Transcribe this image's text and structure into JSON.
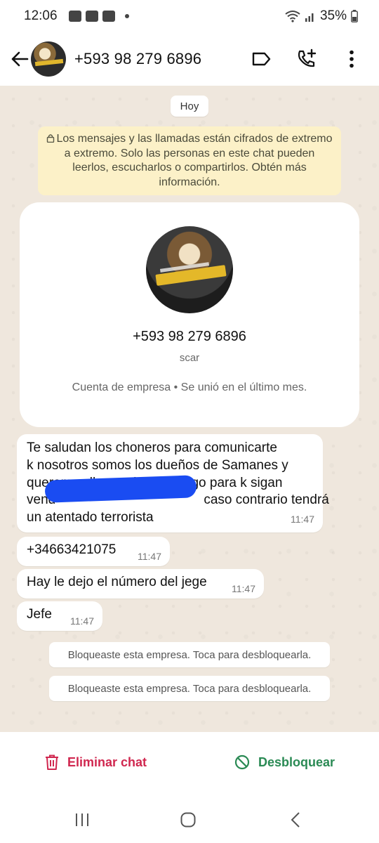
{
  "status_bar": {
    "time": "12:06",
    "battery": "35%"
  },
  "header": {
    "contact_phone": "+593 98 279 6896"
  },
  "chat": {
    "date_label": "Hoy",
    "encryption_notice": "Los mensajes y las llamadas están cifrados de extremo a extremo. Solo las personas en este chat pueden leerlos, escucharlos o compartirlos. Obtén más información.",
    "profile_card": {
      "phone": "+593 98 279 6896",
      "name": "scar",
      "description": "Cuenta de empresa • Se unió en el último mes."
    },
    "messages": [
      {
        "lines": [
          "Te saludan los choneros para comunicarte",
          "k nosotros somos los dueños de Samanes y",
          "queremos llegar ah un diálogo para k sigan",
          "vend                                        caso contrario tendrá",
          "un atentado terrorista"
        ],
        "time": "11:47"
      },
      {
        "text": "+34663421075",
        "time": "11:47"
      },
      {
        "text": "Hay le dejo el número del jege",
        "time": "11:47"
      },
      {
        "text": "Jefe",
        "time": "11:47"
      }
    ],
    "system_messages": [
      "Bloqueaste esta empresa. Toca para desbloquearla.",
      "Bloqueaste esta empresa. Toca para desbloquearla."
    ]
  },
  "actions": {
    "delete_label": "Eliminar chat",
    "unblock_label": "Desbloquear"
  },
  "colors": {
    "chat_background": "#efe7dd",
    "encryption_notice_bg": "#fcf1c8",
    "delete_red": "#d0274f",
    "unblock_green": "#2a8a54",
    "redaction_blue": "#1a4cf2"
  }
}
